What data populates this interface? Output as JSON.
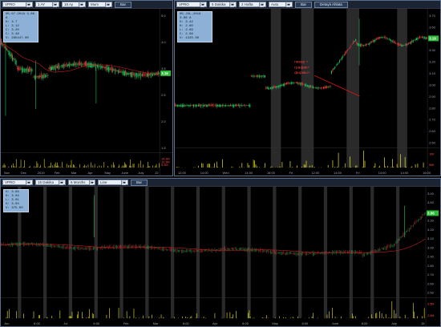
{
  "colors": {
    "up": "#22c55e",
    "down": "#e23b3b",
    "ma": "#c81e1e",
    "session": "#2a2a2a",
    "volume": "#e8e020",
    "lastPrice": "#2dbb3a"
  },
  "panel1": {
    "symbol": "VPRO",
    "interval": "1 AY",
    "period": "18 Ay",
    "type": "Mum",
    "button": "Bar",
    "ohlc": [
      "05.07.2019 3.86 A",
      "H: 3.7",
      "L: 3.12",
      "C: 3.20",
      "C: 3.48",
      "V: 285447.00"
    ],
    "last_price": "3.15",
    "y_ticks": [
      "5.0",
      "4.0",
      "3.5",
      "2.5",
      "2.0",
      "1.5"
    ],
    "x_ticks": [
      "Nov",
      "Dec",
      "2019",
      "Feb",
      "Mar",
      "Apr",
      "May",
      "June",
      "July",
      "22"
    ],
    "vol_ticks": [
      "15.3M",
      "10.3M",
      "5.3M"
    ]
  },
  "panel2": {
    "symbol": "VPRO",
    "interval": "5 Dakika",
    "period": "2 Hafta",
    "type": "Auto",
    "button": "Bar",
    "extra_button": "Detaylı Ahlata",
    "ohlc": [
      "05.JUL.2019 3.86 A",
      "O: 3.42",
      "H: 2.60",
      "L: 2.69",
      "C: 2.96",
      "V: 1220.30"
    ],
    "last_price": "3.19",
    "annotation": [
      "пикер +",
      "график+",
      "фирмы+"
    ],
    "y_ticks": [
      "3.70",
      "3.50",
      "3.40",
      "3.30",
      "3.20",
      "3.10",
      "3.00",
      "2.90",
      "2.80",
      "2.70",
      "2.60",
      "2.50"
    ],
    "x_ticks": [
      "12:00",
      "14:00",
      "Wed",
      "14:00",
      "16:00",
      "Fri",
      "12:00",
      "14:00",
      "Fri",
      "14:00",
      "14:00",
      "16:00"
    ],
    "vol_ticks": [
      "10K",
      "50K"
    ]
  },
  "panel3": {
    "symbol": "VPRO",
    "interval": "15 Dakika",
    "period": "6 Months",
    "type": "Line",
    "button": "Bar",
    "ohlc": [
      "O: 3.89",
      "H: 3.04",
      "L: 3.01",
      "O: 3.04",
      "V: 375.00"
    ],
    "last_price": "3.06",
    "y_ticks": [
      "3.00",
      "3.50",
      "3.40",
      "3.30",
      "3.20",
      "3.10",
      "3.00",
      "2.90",
      "2.80",
      "2.70",
      "2.60",
      "2.50"
    ],
    "x_ticks": [
      "Jun",
      "8:00",
      "Jul",
      "8:00",
      "Feb",
      "Mar",
      "8:00",
      "Apr",
      "8:00",
      "May",
      "8:00",
      "June",
      "8:00",
      "July",
      "15"
    ],
    "vol_ticks": [
      "3.5M",
      "2.0M"
    ]
  }
}
